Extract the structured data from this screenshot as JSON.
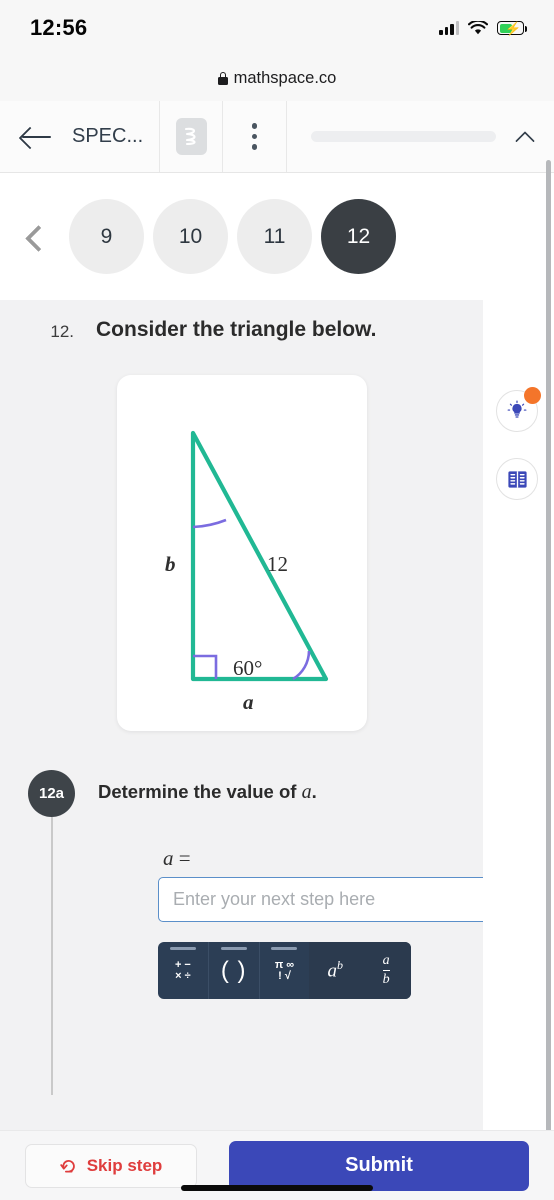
{
  "status_bar": {
    "time": "12:56",
    "signal_icon": "cellular-signal-icon",
    "wifi_icon": "wifi-icon",
    "battery_icon": "battery-charging-icon"
  },
  "browser": {
    "lock_icon": "lock-icon",
    "url": "mathspace.co"
  },
  "toolbar": {
    "back_icon": "back-arrow-icon",
    "title": "SPEC...",
    "logo_icon": "mathspace-logo-icon",
    "more_icon": "more-options-icon",
    "collapse_icon": "chevron-up-icon",
    "progress_percent": 0
  },
  "question_nav": {
    "prev_icon": "chevron-left-icon",
    "items": [
      {
        "label": "9",
        "active": false
      },
      {
        "label": "10",
        "active": false
      },
      {
        "label": "11",
        "active": false
      },
      {
        "label": "12",
        "active": true
      }
    ]
  },
  "question": {
    "number": "12.",
    "prompt": "Consider the triangle below."
  },
  "figure": {
    "type": "right-triangle-diagram",
    "stroke_color": "#21b894",
    "angle_color": "#7b6ce0",
    "labels": {
      "vertical_side": "b",
      "hypotenuse": "12",
      "horizontal_side": "a",
      "angle": "60°"
    },
    "right_angle_marker": true,
    "top_angle_arc": true
  },
  "sub_step": {
    "badge": "12a",
    "prompt_prefix": "Determine the value of ",
    "prompt_variable": "a",
    "prompt_suffix": ".",
    "equation_variable": "a",
    "equation_operator": "=",
    "input_placeholder": "Enter your next step here",
    "input_value": ""
  },
  "math_keyboard": {
    "buttons": [
      {
        "name": "operators",
        "glyph_top": "+ −",
        "glyph_bottom": "× ÷"
      },
      {
        "name": "parentheses",
        "glyph": "( )"
      },
      {
        "name": "symbols",
        "glyph_top": "π ∞",
        "glyph_bottom": "! √"
      },
      {
        "name": "exponent",
        "base": "a",
        "power": "b"
      },
      {
        "name": "fraction",
        "numerator": "a",
        "denominator": "b"
      }
    ]
  },
  "tools": {
    "hint_icon": "lightbulb-icon",
    "hint_has_notification": true,
    "reference_icon": "book-reference-icon"
  },
  "actions": {
    "skip_icon": "skip-arrow-icon",
    "skip_label": "Skip step",
    "submit_label": "Submit"
  },
  "colors": {
    "accent_blue": "#3b48b8",
    "skip_red": "#df3d3d",
    "triangle_teal": "#21b894",
    "angle_purple": "#7b6ce0",
    "notification_orange": "#f4752a",
    "active_pill": "#3a3f44"
  }
}
